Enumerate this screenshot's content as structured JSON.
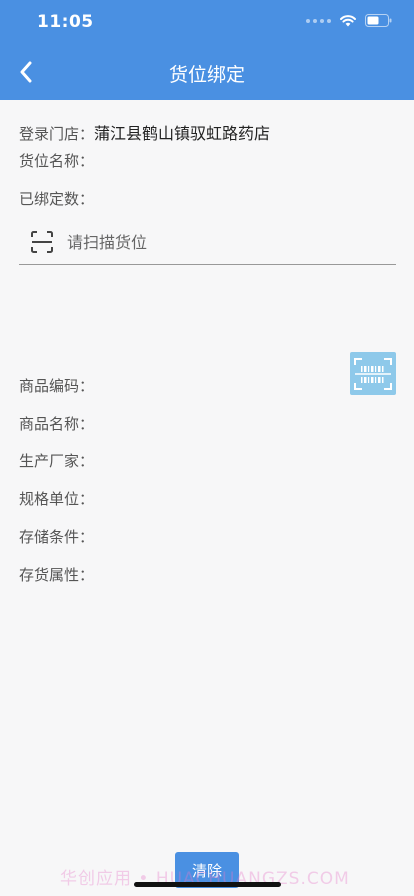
{
  "status_bar": {
    "time": "11:05",
    "icons": [
      "signal-dots-icon",
      "wifi-icon",
      "battery-icon"
    ]
  },
  "nav": {
    "title": "货位绑定",
    "back_icon": "chevron-left-icon"
  },
  "store": {
    "label": "登录门店：",
    "value": "蒲江县鹤山镇驭虹路药店"
  },
  "location": {
    "name_label": "货位名称：",
    "bound_label": "已绑定数："
  },
  "scan": {
    "placeholder": "请扫描货位",
    "icon": "scan-frame-icon"
  },
  "product": {
    "code_label": "商品编码：",
    "name_label": "商品名称：",
    "maker_label": "生产厂家：",
    "spec_label": "规格单位：",
    "storage_label": "存储条件：",
    "attr_label": "存货属性："
  },
  "barcode_button_icon": "barcode-scan-icon",
  "footer": {
    "clear_label": "清除",
    "watermark": "华创应用 • HUACHUANGZS.COM"
  },
  "colors": {
    "primary": "#4a90e2",
    "barcode_button": "#8ec9ea",
    "background": "#f7f7f8"
  }
}
